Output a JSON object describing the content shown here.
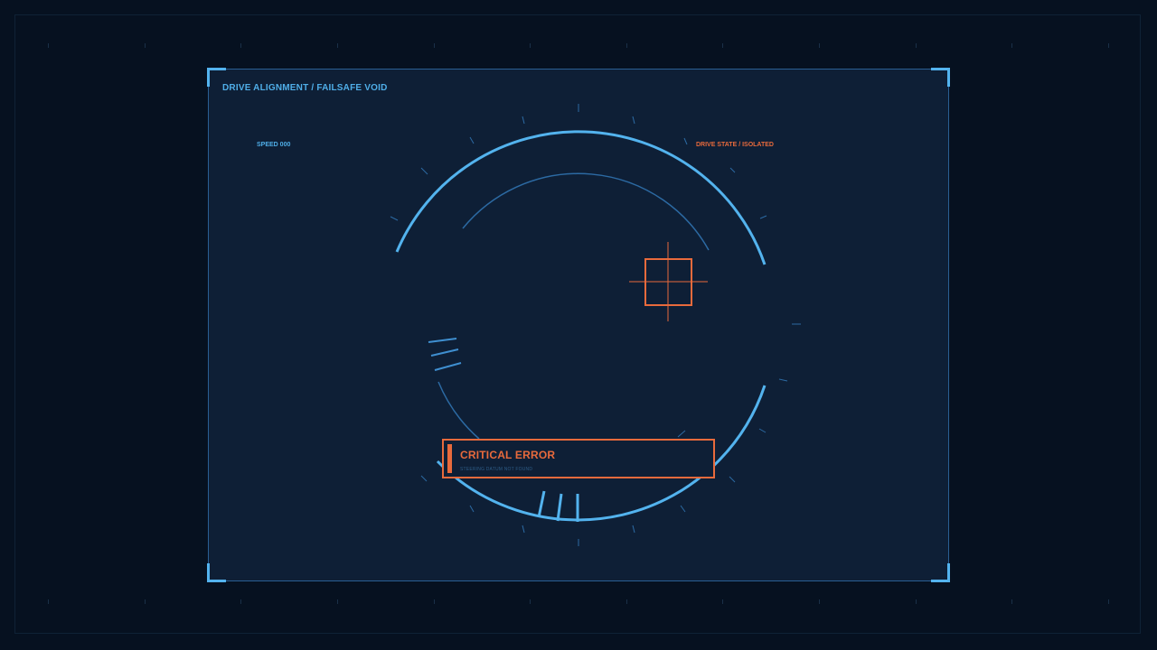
{
  "hud": {
    "title": "DRIVE ALIGNMENT / FAILSAFE VOID",
    "speed_label": "SPEED 000",
    "drive_state": "DRIVE STATE / ISOLATED"
  },
  "alert": {
    "title": "CRITICAL ERROR",
    "message": "STEERING DATUM NOT FOUND"
  },
  "colors": {
    "background": "#061120",
    "panel": "#0e1f36",
    "accent_blue": "#53b3ee",
    "accent_orange": "#e86a3c"
  },
  "icons": {
    "target": "crosshair-reticle-icon",
    "gauge": "steering-ring-gauge"
  }
}
